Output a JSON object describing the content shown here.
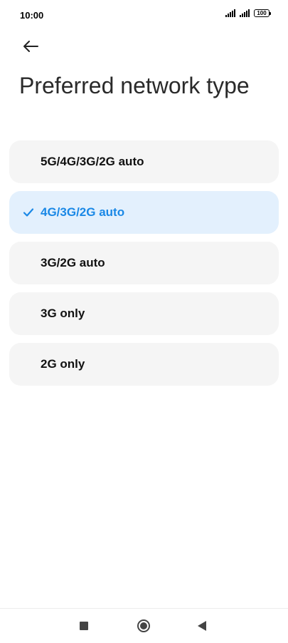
{
  "status_bar": {
    "time": "10:00",
    "battery_level": "100",
    "signal_icons": [
      "signal-icon",
      "signal-icon"
    ]
  },
  "header": {
    "back_icon": "arrow-left-icon",
    "title": "Preferred network type"
  },
  "options": [
    {
      "label": "5G/4G/3G/2G auto",
      "selected": false
    },
    {
      "label": "4G/3G/2G auto",
      "selected": true
    },
    {
      "label": "3G/2G auto",
      "selected": false
    },
    {
      "label": "3G only",
      "selected": false
    },
    {
      "label": "2G only",
      "selected": false
    }
  ],
  "colors": {
    "accent": "#1a88e6",
    "selected_background": "#e3f0fd",
    "option_background": "#f5f5f5"
  },
  "nav_bar": {
    "icons": [
      "square-icon",
      "circle-icon",
      "triangle-back-icon"
    ]
  }
}
